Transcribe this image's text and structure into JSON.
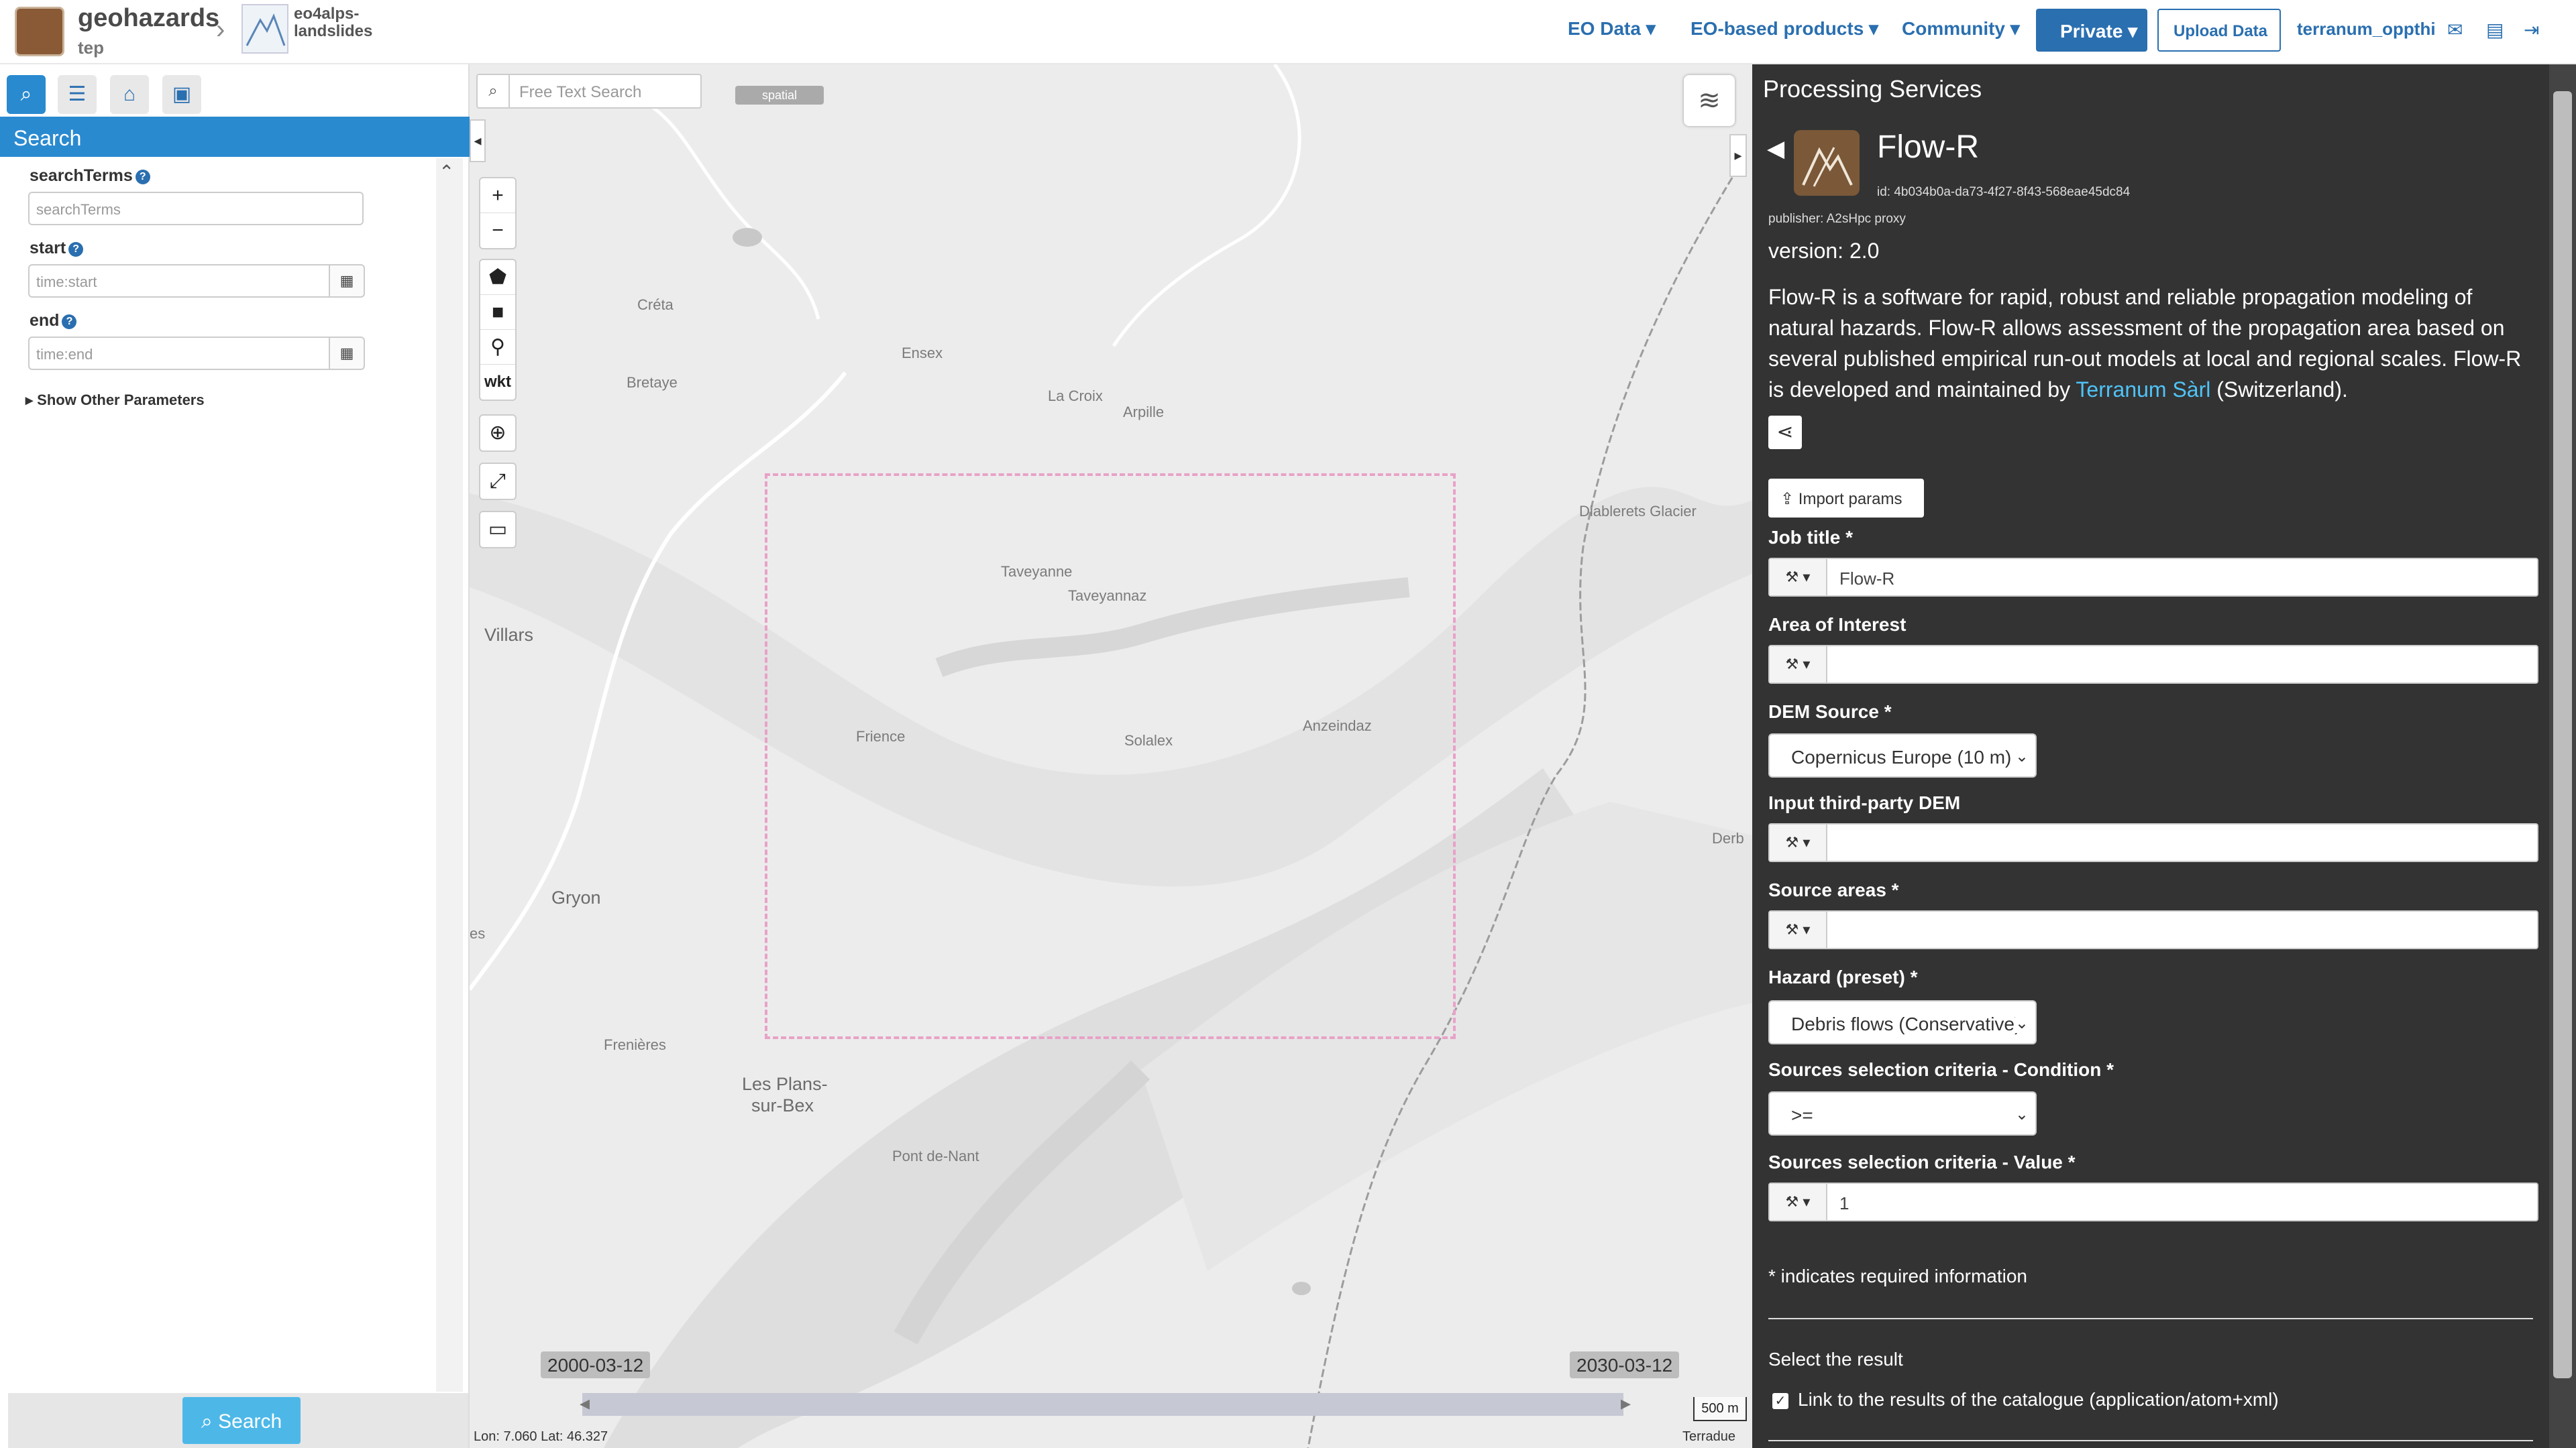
{
  "header": {
    "brand_name": "geohazards",
    "brand_sub": "tep",
    "community_name": "eo4alps-landslides",
    "nav": {
      "eo_data": "EO Data",
      "eo_products": "EO-based products",
      "community": "Community",
      "private": "Private",
      "upload": "Upload Data",
      "user": "terranum_oppthi"
    },
    "icons": [
      "mail-icon",
      "book-icon",
      "sign-out-icon"
    ]
  },
  "left_panel": {
    "header": "Search",
    "fields": {
      "searchTerms": {
        "label": "searchTerms",
        "placeholder": "searchTerms"
      },
      "start": {
        "label": "start",
        "placeholder": "time:start"
      },
      "end": {
        "label": "end",
        "placeholder": "time:end"
      }
    },
    "show_other": "Show Other Parameters",
    "search_button": "Search"
  },
  "map": {
    "search_placeholder": "Free Text Search",
    "spatial_tag": "spatial",
    "draw_tools": [
      "+",
      "−"
    ],
    "wkt_label": "wkt",
    "places": {
      "creta": "Créta",
      "bretaye": "Bretaye",
      "ensex": "Ensex",
      "la_croix": "La Croix",
      "arpille": "Arpille",
      "diablerets": "Diablerets Glacier",
      "villars": "Villars",
      "taveyanne": "Taveyanne",
      "taveyannaz": "Taveyannaz",
      "frience": "Frience",
      "solalex": "Solalex",
      "anzeindaz": "Anzeindaz",
      "derb": "Derb",
      "gryon": "Gryon",
      "es": "es",
      "frenieres": "Frenières",
      "les_plans": "Les Plans-",
      "sur_bex": "sur-Bex",
      "pont_de_nant": "Pont de-Nant"
    },
    "time_start": "2000-03-12",
    "time_end": "2030-03-12",
    "coords": "Lon: 7.060 Lat: 46.327",
    "scale": "500 m",
    "attribution": "Terradue"
  },
  "service": {
    "panel_title": "Processing Services",
    "name": "Flow-R",
    "id": "id: 4b034b0a-da73-4f27-8f43-568eae45dc84",
    "publisher": "publisher: A2sHpc proxy",
    "version": "version: 2.0",
    "description_pre": "Flow-R is a software for rapid, robust and reliable propagation modeling of natural hazards. Flow-R allows assessment of the propagation area based on several published empirical run-out models at local and regional scales. Flow-R is developed and maintained by ",
    "description_link": "Terranum Sàrl",
    "description_post": " (Switzerland).",
    "import_button": "Import params",
    "params": {
      "job_title": {
        "label": "Job title *",
        "value": "Flow-R"
      },
      "aoi": {
        "label": "Area of Interest",
        "value": ""
      },
      "dem_source": {
        "label": "DEM Source *",
        "value": "Copernicus Europe (10 m)"
      },
      "third_party_dem": {
        "label": "Input third-party DEM",
        "value": ""
      },
      "source_areas": {
        "label": "Source areas *",
        "value": ""
      },
      "hazard": {
        "label": "Hazard (preset) *",
        "value": "Debris flows (Conservative)"
      },
      "condition": {
        "label": "Sources selection criteria - Condition *",
        "value": ">="
      },
      "value": {
        "label": "Sources selection criteria - Value *",
        "value": "1"
      }
    },
    "required_note": "* indicates required information",
    "select_result": "Select the result",
    "result_link_label": "Link to the results of the catalogue (application/atom+xml)"
  }
}
